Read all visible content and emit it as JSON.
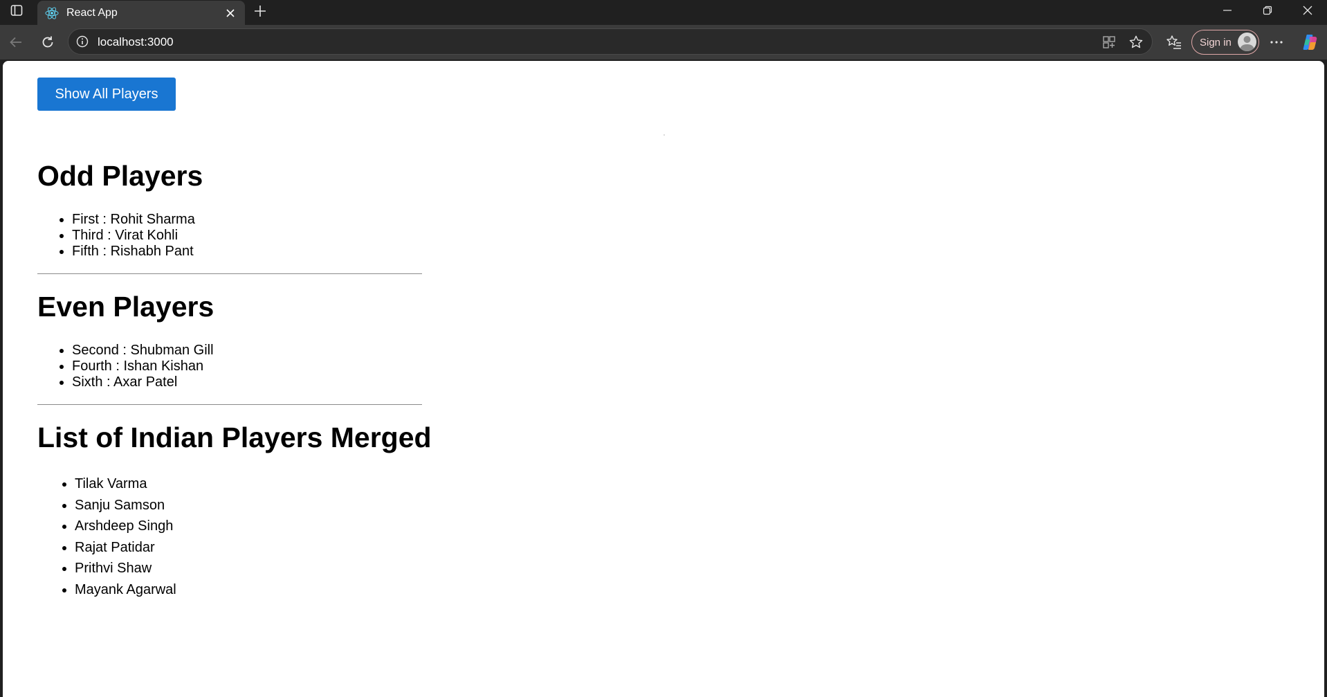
{
  "browser": {
    "tab_title": "React App",
    "url": "localhost:3000",
    "sign_in_label": "Sign in"
  },
  "page": {
    "show_button_label": "Show All Players",
    "odd": {
      "heading": "Odd Players",
      "items": [
        "First : Rohit Sharma",
        "Third : Virat Kohli",
        "Fifth : Rishabh Pant"
      ]
    },
    "even": {
      "heading": "Even Players",
      "items": [
        "Second : Shubman Gill",
        "Fourth : Ishan Kishan",
        "Sixth : Axar Patel"
      ]
    },
    "merged": {
      "heading": "List of Indian Players Merged",
      "items": [
        "Tilak Varma",
        "Sanju Samson",
        "Arshdeep Singh",
        "Rajat Patidar",
        "Prithvi Shaw",
        "Mayank Agarwal"
      ]
    }
  },
  "colors": {
    "button_bg": "#1976d2",
    "react_logo": "#61dafb"
  }
}
